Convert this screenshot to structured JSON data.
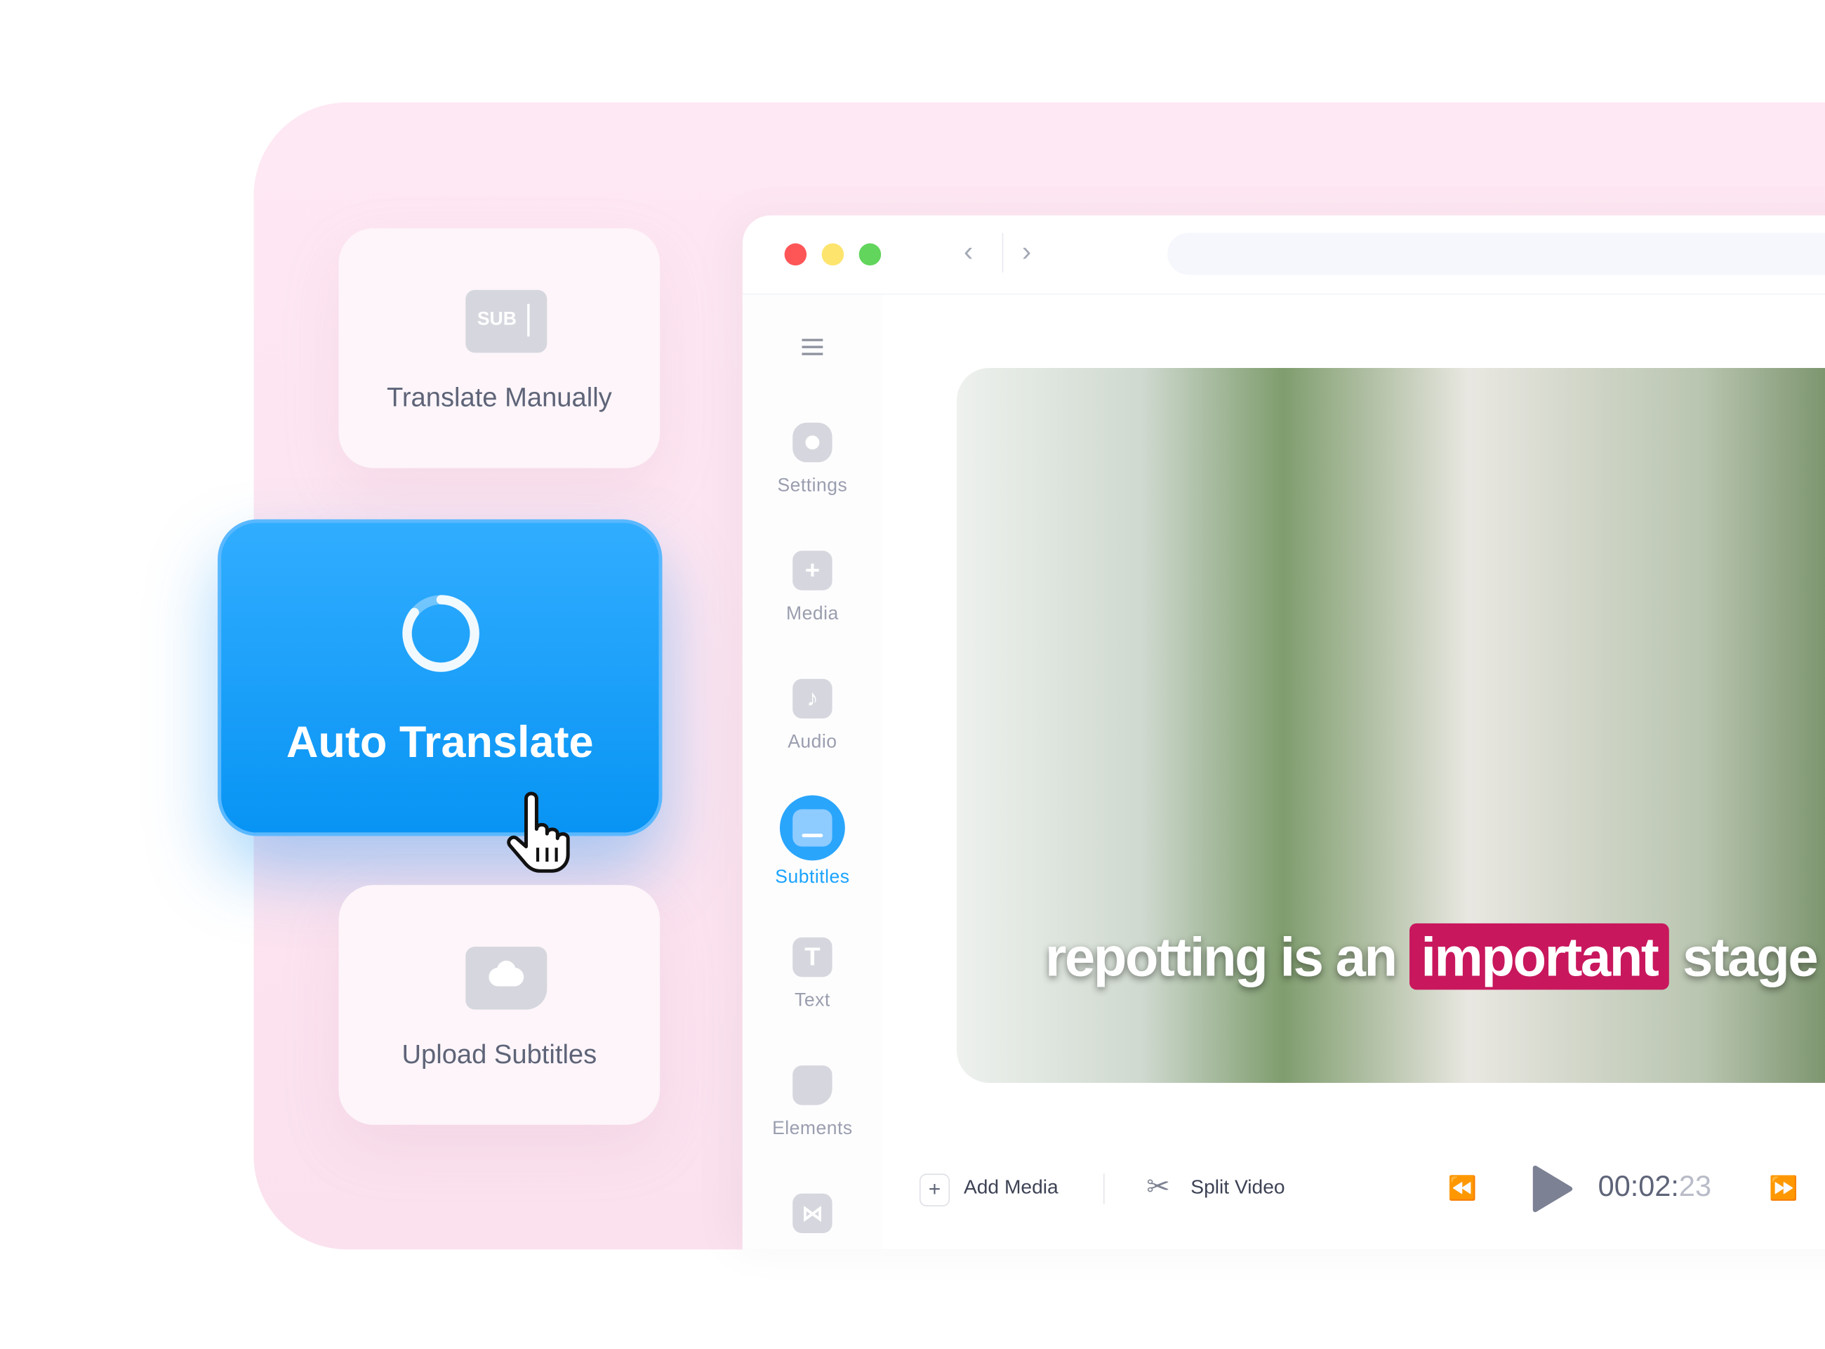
{
  "options": {
    "translate_manually": {
      "label": "Translate Manually",
      "icon_text": "SUB"
    },
    "auto_translate": {
      "label": "Auto Translate"
    },
    "upload_subtitles": {
      "label": "Upload Subtitles"
    }
  },
  "sidebar": {
    "items": [
      {
        "label": "Settings",
        "icon": "gear-icon"
      },
      {
        "label": "Media",
        "icon": "plus-icon"
      },
      {
        "label": "Audio",
        "icon": "music-note-icon"
      },
      {
        "label": "Subtitles",
        "icon": "subtitles-icon",
        "active": true
      },
      {
        "label": "Text",
        "icon": "text-icon"
      },
      {
        "label": "Elements",
        "icon": "sticker-icon"
      },
      {
        "label": "",
        "icon": "transition-icon"
      }
    ]
  },
  "video": {
    "subtitle_before": "repotting is an",
    "subtitle_highlight": "important",
    "subtitle_after": "stage"
  },
  "toolbar": {
    "add_media": "Add Media",
    "split_video": "Split Video",
    "time_main": "00:02:",
    "time_frames": "23"
  },
  "colors": {
    "accent": "#1aa3ff",
    "highlight": "#c8175d",
    "background": "#fde6f1"
  }
}
